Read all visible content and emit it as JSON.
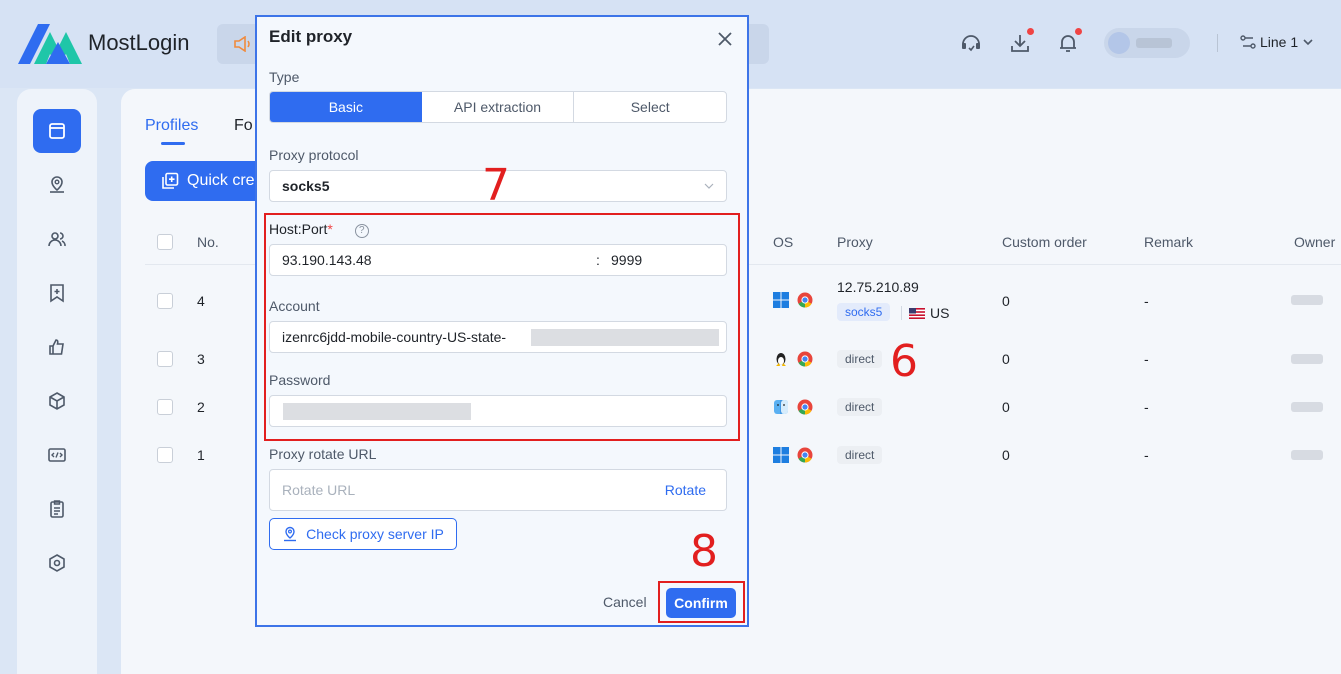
{
  "app": {
    "name": "MostLogin"
  },
  "header": {
    "line_selector": "Line 1"
  },
  "tabs": {
    "profiles": "Profiles",
    "folders": "Fo"
  },
  "toolbar": {
    "quick_create": "Quick cre"
  },
  "table": {
    "headers": {
      "no": "No.",
      "os": "OS",
      "proxy": "Proxy",
      "custom_order": "Custom order",
      "remark": "Remark",
      "owner": "Owner"
    },
    "rows": [
      {
        "no": "4",
        "os": "windows",
        "browser": "chrome",
        "proxy_ip": "12.75.210.89",
        "proxy_type": "socks5",
        "country": "US",
        "custom_order": "0",
        "remark": "-"
      },
      {
        "no": "3",
        "os": "linux",
        "browser": "chrome",
        "proxy_type": "direct",
        "custom_order": "0",
        "remark": "-"
      },
      {
        "no": "2",
        "os": "mac",
        "browser": "chrome",
        "proxy_type": "direct",
        "custom_order": "0",
        "remark": "-"
      },
      {
        "no": "1",
        "os": "windows",
        "browser": "chrome",
        "proxy_type": "direct",
        "custom_order": "0",
        "remark": "-"
      }
    ]
  },
  "modal": {
    "title": "Edit proxy",
    "type_label": "Type",
    "type_options": [
      "Basic",
      "API extraction",
      "Select"
    ],
    "type_selected": "Basic",
    "protocol_label": "Proxy protocol",
    "protocol_value": "socks5",
    "host_port_label": "Host:Port",
    "required_mark": "*",
    "help_icon": "?",
    "host": "93.190.143.48",
    "port_sep": ":",
    "port": "9999",
    "account_label": "Account",
    "account_value": "izenrc6jdd-mobile-country-US-state-",
    "password_label": "Password",
    "rotate_label": "Proxy rotate URL",
    "rotate_placeholder": "Rotate URL",
    "rotate_link": "Rotate",
    "check_button": "Check proxy server IP",
    "cancel": "Cancel",
    "confirm": "Confirm"
  },
  "annotations": {
    "step6": "6",
    "step7": "7",
    "step8": "8"
  },
  "colors": {
    "accent": "#2f6cf0",
    "annotation": "#e21f1f"
  }
}
